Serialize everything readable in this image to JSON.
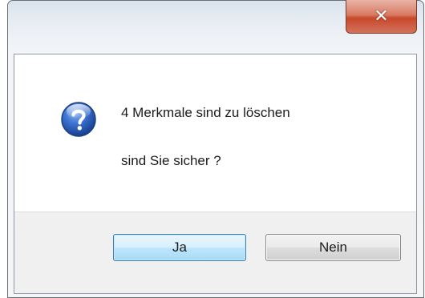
{
  "dialog": {
    "close_glyph": "✕",
    "message_line1": "4 Merkmale sind zu löschen",
    "message_line2": "sind Sie sicher ?",
    "icon": "question-icon",
    "buttons": {
      "yes_label": "Ja",
      "no_label": "Nein"
    }
  },
  "colors": {
    "close_button": "#c8482b",
    "default_button_border": "#3c7fb1",
    "icon_blue": "#2f67c6"
  }
}
